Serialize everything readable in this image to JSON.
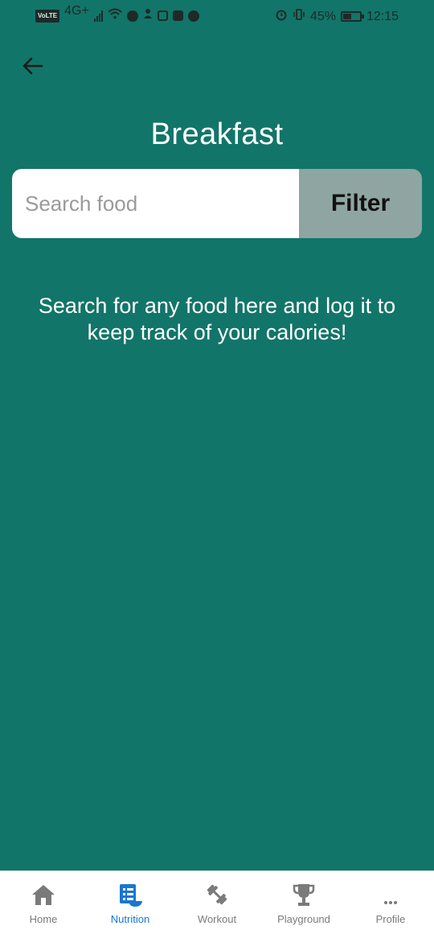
{
  "status_bar": {
    "volte": "VoLTE",
    "network": "4G+",
    "battery_percent": "45%",
    "battery_level": 0.45,
    "time": "12:15"
  },
  "header": {
    "title": "Breakfast",
    "back_icon": "arrow-left-icon"
  },
  "search": {
    "placeholder": "Search food",
    "value": "",
    "filter_label": "Filter"
  },
  "main": {
    "hint": "Search for any food here and log it to keep track of your calories!"
  },
  "bottom_nav": {
    "items": [
      {
        "label": "Home",
        "icon": "home-icon",
        "active": false
      },
      {
        "label": "Nutrition",
        "icon": "nutrition-icon",
        "active": true
      },
      {
        "label": "Workout",
        "icon": "dumbbell-icon",
        "active": false
      },
      {
        "label": "Playground",
        "icon": "trophy-icon",
        "active": false
      },
      {
        "label": "Profile",
        "icon": "more-icon",
        "active": false
      }
    ]
  },
  "colors": {
    "background": "#127569",
    "filter_button": "#8fa5a1",
    "active_nav": "#1976d2",
    "inactive_nav": "#7a7a7a"
  }
}
